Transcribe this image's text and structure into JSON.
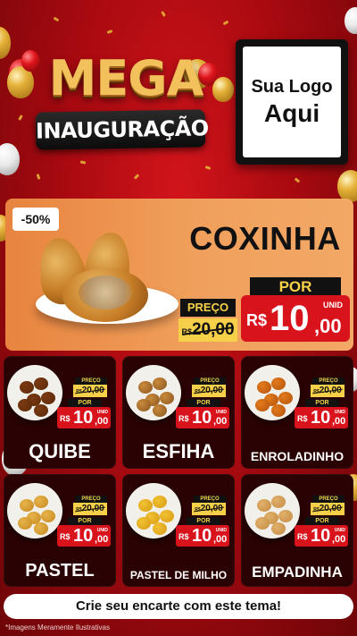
{
  "header": {
    "mega": "MEGA",
    "inauguracao": "INAUGURAÇÃO",
    "logo_line1": "Sua Logo",
    "logo_line2": "Aqui"
  },
  "hero": {
    "discount_badge": "-50%",
    "name": "COXINHA",
    "preco_label": "PREÇO",
    "old_currency": "R$",
    "old_price": "20,00",
    "por_label": "POR",
    "currency": "R$",
    "price_int": "10",
    "price_cents": ",00",
    "unit": "UNID"
  },
  "price_labels": {
    "preco": "PREÇO",
    "por": "POR",
    "currency": "R$",
    "unit": "UNID",
    "old_int": "20",
    "old_cents": ",00",
    "new_int": "10",
    "new_cents": ",00"
  },
  "products": [
    {
      "name": "QUIBE"
    },
    {
      "name": "ESFIHA"
    },
    {
      "name": "ENROLADINHO"
    },
    {
      "name": "PASTEL"
    },
    {
      "name": "PASTEL DE MILHO"
    },
    {
      "name": "EMPADINHA"
    }
  ],
  "banner": "Crie seu encarte com este tema!",
  "footnote": "*Imagens Meramente Ilustrativas",
  "colors": {
    "background": "#b80d13",
    "price_red": "#d9131c",
    "price_yellow": "#f6d048",
    "hero_orange": "#ee9a55",
    "card_dark": "#2a0203"
  }
}
